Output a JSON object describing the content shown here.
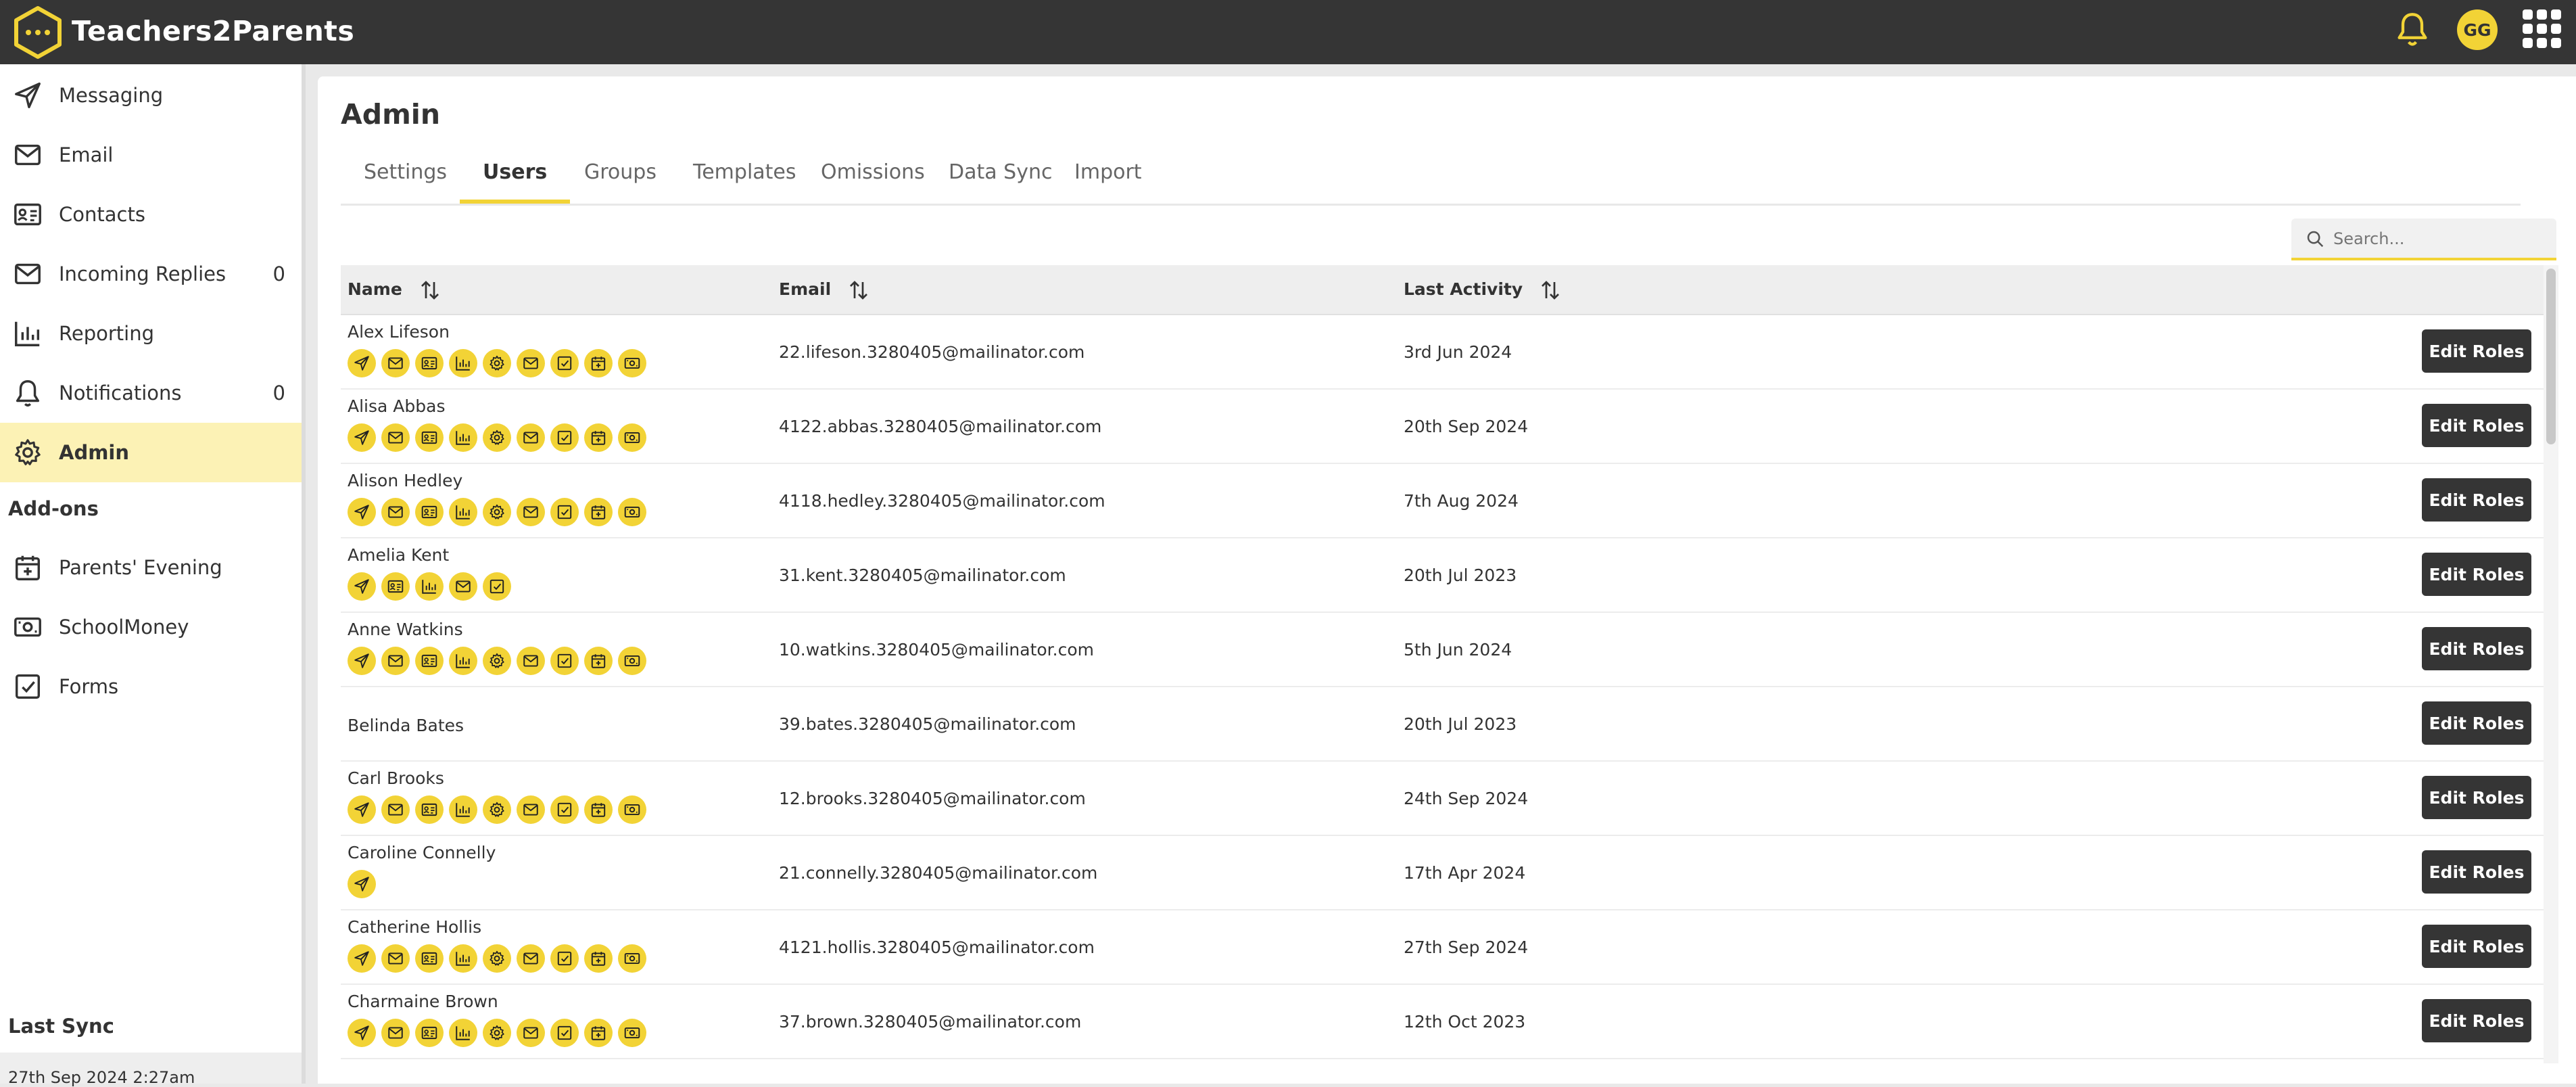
{
  "app": {
    "title": "Teachers2Parents",
    "avatar_initials": "GG",
    "accent_color": "#f2d336",
    "topbar_color": "#353535"
  },
  "sidebar": {
    "items": [
      {
        "label": "Messaging",
        "icon": "send-icon"
      },
      {
        "label": "Email",
        "icon": "mail-icon"
      },
      {
        "label": "Contacts",
        "icon": "contact-card-icon"
      },
      {
        "label": "Incoming Replies",
        "icon": "mail-icon",
        "count": "0"
      },
      {
        "label": "Reporting",
        "icon": "bar-chart-icon"
      },
      {
        "label": "Notifications",
        "icon": "bell-icon",
        "count": "0"
      },
      {
        "label": "Admin",
        "icon": "gear-icon",
        "active": true
      }
    ],
    "addons_heading": "Add-ons",
    "addons": [
      {
        "label": "Parents' Evening",
        "icon": "calendar-icon"
      },
      {
        "label": "SchoolMoney",
        "icon": "money-icon"
      },
      {
        "label": "Forms",
        "icon": "checkbox-icon"
      }
    ],
    "last_sync_label": "Last Sync",
    "last_sync_value": "27th Sep 2024 2:27am"
  },
  "main": {
    "title": "Admin",
    "tabs": [
      {
        "label": "Settings"
      },
      {
        "label": "Users",
        "active": true
      },
      {
        "label": "Groups"
      },
      {
        "label": "Templates"
      },
      {
        "label": "Omissions"
      },
      {
        "label": "Data Sync"
      },
      {
        "label": "Import"
      }
    ],
    "search_placeholder": "Search...",
    "columns": {
      "name": "Name",
      "email": "Email",
      "last_activity": "Last Activity"
    },
    "edit_label": "Edit Roles",
    "users": [
      {
        "name": "Alex Lifeson",
        "email": "22.lifeson.3280405@mailinator.com",
        "last_activity": "3rd Jun 2024",
        "roles": [
          "send",
          "mail",
          "contact",
          "chart",
          "gear",
          "mail",
          "check",
          "calendar",
          "money"
        ]
      },
      {
        "name": "Alisa Abbas",
        "email": "4122.abbas.3280405@mailinator.com",
        "last_activity": "20th Sep 2024",
        "roles": [
          "send",
          "mail",
          "contact",
          "chart",
          "gear",
          "mail",
          "check",
          "calendar",
          "money"
        ]
      },
      {
        "name": "Alison Hedley",
        "email": "4118.hedley.3280405@mailinator.com",
        "last_activity": "7th Aug 2024",
        "roles": [
          "send",
          "mail",
          "contact",
          "chart",
          "gear",
          "mail",
          "check",
          "calendar",
          "money"
        ]
      },
      {
        "name": "Amelia Kent",
        "email": "31.kent.3280405@mailinator.com",
        "last_activity": "20th Jul 2023",
        "roles": [
          "send",
          "contact",
          "chart",
          "mail",
          "check"
        ]
      },
      {
        "name": "Anne Watkins",
        "email": "10.watkins.3280405@mailinator.com",
        "last_activity": "5th Jun 2024",
        "roles": [
          "send",
          "mail",
          "contact",
          "chart",
          "gear",
          "mail",
          "check",
          "calendar",
          "money"
        ]
      },
      {
        "name": "Belinda Bates",
        "email": "39.bates.3280405@mailinator.com",
        "last_activity": "20th Jul 2023",
        "roles": []
      },
      {
        "name": "Carl Brooks",
        "email": "12.brooks.3280405@mailinator.com",
        "last_activity": "24th Sep 2024",
        "roles": [
          "send",
          "mail",
          "contact",
          "chart",
          "gear",
          "mail",
          "check",
          "calendar",
          "money"
        ]
      },
      {
        "name": "Caroline Connelly",
        "email": "21.connelly.3280405@mailinator.com",
        "last_activity": "17th Apr 2024",
        "roles": [
          "send"
        ]
      },
      {
        "name": "Catherine Hollis",
        "email": "4121.hollis.3280405@mailinator.com",
        "last_activity": "27th Sep 2024",
        "roles": [
          "send",
          "mail",
          "contact",
          "chart",
          "gear",
          "mail",
          "check",
          "calendar",
          "money"
        ]
      },
      {
        "name": "Charmaine Brown",
        "email": "37.brown.3280405@mailinator.com",
        "last_activity": "12th Oct 2023",
        "roles": [
          "send",
          "mail",
          "contact",
          "chart",
          "gear",
          "mail",
          "check",
          "calendar",
          "money"
        ]
      }
    ]
  }
}
